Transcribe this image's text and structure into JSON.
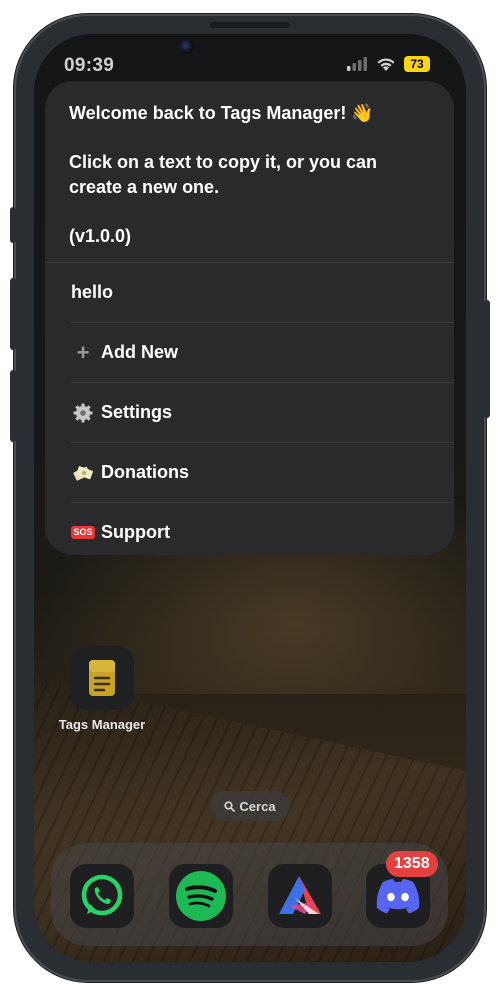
{
  "status_bar": {
    "time": "09:39",
    "battery": "73",
    "signal_icon": "cellular-signal-icon",
    "wifi_icon": "wifi-icon"
  },
  "menu": {
    "header_lines": [
      "Welcome back to Tags Manager! 👋",
      "Click on a text to copy it, or you can",
      "create a new one.",
      "(v1.0.0)"
    ],
    "items": [
      {
        "label": "hello",
        "icon": null
      },
      {
        "label": "Add New",
        "icon": "plus-icon"
      },
      {
        "label": "Settings",
        "icon": "gear-icon"
      },
      {
        "label": "Donations",
        "icon": "money-icon"
      },
      {
        "label": "Support",
        "icon": "sos-icon"
      }
    ],
    "sos_text": "SOS"
  },
  "home": {
    "app_label": "Tags Manager",
    "search_label": "Cerca"
  },
  "dock": {
    "apps": [
      "WhatsApp",
      "Spotify",
      "Affinity",
      "Discord"
    ],
    "discord_badge": "1358"
  },
  "colors": {
    "menu_bg": "#2a2a2c",
    "battery": "#ffd60a",
    "badge": "#e54040",
    "whatsapp": "#25d366",
    "spotify": "#1db954",
    "discord": "#5865f2"
  }
}
